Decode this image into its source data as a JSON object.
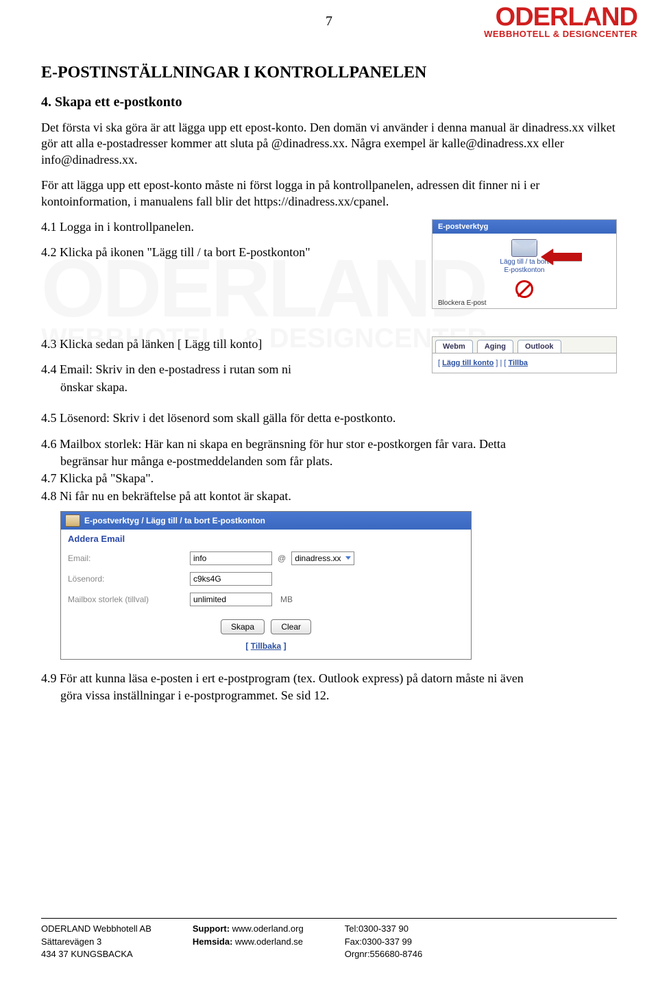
{
  "page_number": "7",
  "logo": {
    "main": "ODERLAND",
    "tag": "WEBBHOTELL & DESIGNCENTER"
  },
  "section_title": "E-POSTINSTÄLLNINGAR I KONTROLLPANELEN",
  "subsection": "4. Skapa ett e-postkonto",
  "para1": "Det första vi ska göra är att lägga upp ett epost-konto. Den domän vi använder i denna manual är dinadress.xx vilket gör att alla e-postadresser kommer att sluta på @dinadress.xx. Några exempel är kalle@dinadress.xx eller info@dinadress.xx.",
  "para2": "För att lägga upp ett epost-konto måste ni först logga in på kontrollpanelen, adressen dit finner ni i er kontoinformation, i manualens fall blir det https://dinadress.xx/cpanel.",
  "step_4_1": "4.1 Logga in i kontrollpanelen.",
  "step_4_2": "4.2 Klicka på ikonen \"Lägg till / ta bort E-postkonton\"",
  "step_4_3": "4.3 Klicka sedan på länken [ Lägg till konto]",
  "step_4_4": "4.4 Email: Skriv in den e-postadress i rutan som ni",
  "step_4_4b": "önskar skapa.",
  "step_4_5": "4.5 Lösenord: Skriv i det lösenord som skall gälla för detta e-postkonto.",
  "step_4_6": "4.6 Mailbox storlek: Här kan ni skapa en begränsning för hur stor e-postkorgen får vara. Detta",
  "step_4_6b": "begränsar hur många e-postmeddelanden som får plats.",
  "step_4_7": "4.7 Klicka på \"Skapa\".",
  "step_4_8": "4.8 Ni får nu en bekräftelse på att kontot är skapat.",
  "step_4_9": "4.9 För att kunna läsa e-posten i ert e-postprogram (tex. Outlook express) på datorn måste ni även",
  "step_4_9b": "göra vissa inställningar i e-postprogrammet. Se sid 12.",
  "shot1": {
    "title": "E-postverktyg",
    "icon1_line1": "Lägg till / ta bort",
    "icon1_line2": "E-postkonton",
    "cutoff": "Blockera E-post"
  },
  "shot2": {
    "tab1": "Webm",
    "tab2": "Aging",
    "tab3": "Outlook",
    "link_pre": "[ ",
    "link": "Lägg till konto",
    "link_post": " ]  |  [ ",
    "link2": "Tillba"
  },
  "shot3": {
    "title": "E-postverktyg / Lägg till / ta bort E-postkonton",
    "subtitle": "Addera Email",
    "label_email": "Email:",
    "label_password": "Lösenord:",
    "label_mailbox": "Mailbox storlek (tillval)",
    "val_email": "info",
    "val_at": "@",
    "val_domain": "dinadress.xx",
    "val_password": "c9ks4G",
    "val_mailbox": "unlimited",
    "unit": "MB",
    "btn_create": "Skapa",
    "btn_clear": "Clear",
    "back_pre": "[ ",
    "back": "Tillbaka",
    "back_post": " ]"
  },
  "footer": {
    "c1l1": "ODERLAND Webbhotell AB",
    "c1l2": "Sättarevägen 3",
    "c1l3": "434 37 KUNGSBACKA",
    "c2l1a": "Support: ",
    "c2l1b": "www.oderland.org",
    "c2l2a": "Hemsida: ",
    "c2l2b": "www.oderland.se",
    "c3l1": "Tel:0300-337 90",
    "c3l2": "Fax:0300-337 99",
    "c3l3": "Orgnr:556680-8746"
  }
}
